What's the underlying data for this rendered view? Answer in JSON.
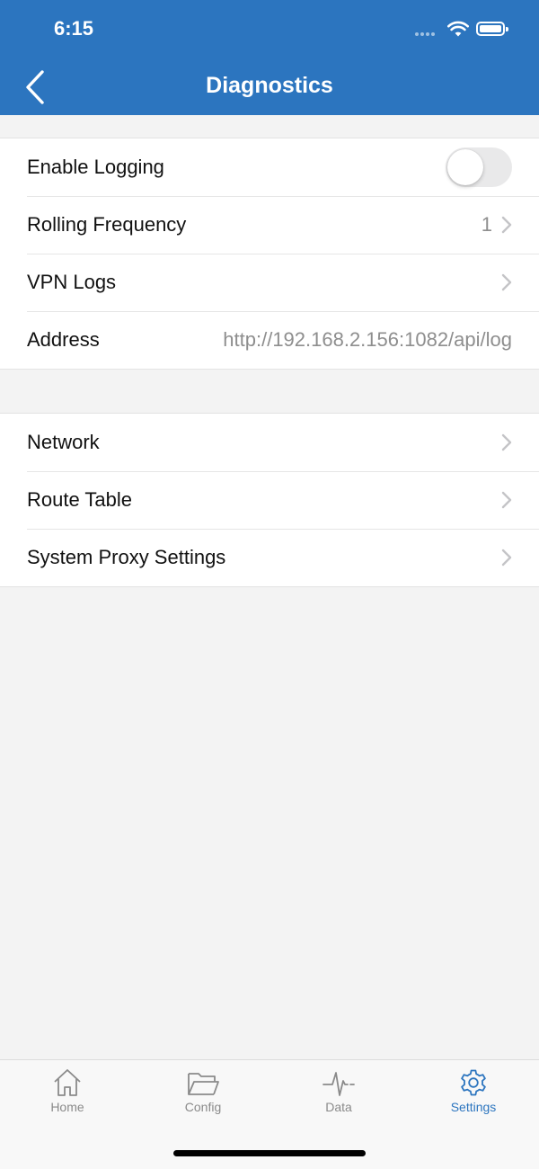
{
  "status_bar": {
    "time": "6:15"
  },
  "nav": {
    "title": "Diagnostics"
  },
  "colors": {
    "accent": "#2c75bf",
    "background": "#f3f3f3"
  },
  "section1": {
    "enable_logging": {
      "label": "Enable Logging",
      "enabled": false
    },
    "rolling_frequency": {
      "label": "Rolling Frequency",
      "value": "1"
    },
    "vpn_logs": {
      "label": "VPN Logs"
    },
    "address": {
      "label": "Address",
      "value": "http://192.168.2.156:1082/api/log"
    }
  },
  "section2": {
    "network": {
      "label": "Network"
    },
    "route_table": {
      "label": "Route Table"
    },
    "system_proxy": {
      "label": "System Proxy Settings"
    }
  },
  "tabbar": {
    "items": [
      {
        "label": "Home",
        "icon": "home-icon"
      },
      {
        "label": "Config",
        "icon": "folder-icon"
      },
      {
        "label": "Data",
        "icon": "pulse-icon"
      },
      {
        "label": "Settings",
        "icon": "gear-icon"
      }
    ],
    "active": "Settings"
  }
}
